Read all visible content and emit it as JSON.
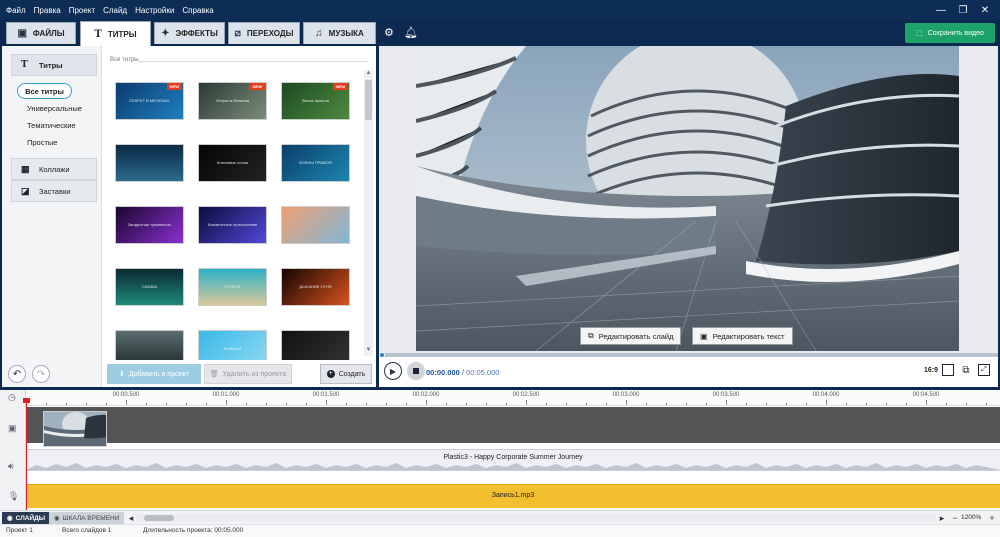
{
  "menu": [
    "Файл",
    "Правка",
    "Проект",
    "Слайд",
    "Настройки",
    "Справка"
  ],
  "tabs": [
    {
      "label": "ФАЙЛЫ",
      "icon": "folder-icon"
    },
    {
      "label": "ТИТРЫ",
      "icon": "text-t-icon"
    },
    {
      "label": "ЭФФЕКТЫ",
      "icon": "effects-star-icon"
    },
    {
      "label": "ПЕРЕХОДЫ",
      "icon": "transitions-icon"
    },
    {
      "label": "МУЗЫКА",
      "icon": "music-note-icon"
    }
  ],
  "save_button": "Сохранить видео",
  "categories": {
    "titles": "Титры",
    "sub": [
      "Все титры",
      "Универсальные",
      "Тематические",
      "Простые"
    ],
    "collages": "Коллажи",
    "intros": "Заставки"
  },
  "gallery": {
    "header": "Все титры",
    "badge": "NEW",
    "items": [
      {
        "caption": "СЕКРЕТ В МЕЛОЧАХ",
        "new": true
      },
      {
        "caption": "Отпуск в Испании",
        "new": true
      },
      {
        "caption": "Весна пришла",
        "new": true
      },
      {
        "caption": "",
        "new": false
      },
      {
        "caption": "Ключевые слова",
        "new": false
      },
      {
        "caption": "ВОЛНЫ ПРИБОЯ",
        "new": false
      },
      {
        "caption": "Загадочная туманность",
        "new": false
      },
      {
        "caption": "Космическое путешествие",
        "new": false
      },
      {
        "caption": "",
        "new": false
      },
      {
        "caption": "СКАЗКА",
        "new": false
      },
      {
        "caption": "ОТПУСК",
        "new": false
      },
      {
        "caption": "ДЫХАНИЕ ОГНЯ",
        "new": false
      },
      {
        "caption": "",
        "new": false
      },
      {
        "caption": "БОКАЛЫ",
        "new": false
      },
      {
        "caption": "",
        "new": false
      }
    ]
  },
  "buttons": {
    "add": "Добавить в проект",
    "remove": "Удалить из проекта",
    "create": "Создать"
  },
  "preview": {
    "edit_slide": "Редактировать слайд",
    "edit_text": "Редактировать текст",
    "current_time": "00:00.000",
    "separator": "/",
    "total_time": "00:05.000",
    "aspect": "16:9",
    "progress": 0
  },
  "timeline": {
    "ticks": [
      "00:00.500",
      "00:01.000",
      "00:01.500",
      "00:02.000",
      "00:02.500",
      "00:03.000",
      "00:03.500",
      "00:04.000",
      "00:04.500"
    ],
    "audio_track": "Plastic3 - Happy Corporate Summer Journey",
    "voice_track": "Запись1.mp3"
  },
  "modes": {
    "slides": "СЛАЙДЫ",
    "timeline": "ШКАЛА ВРЕМЕНИ"
  },
  "zoom": "1200%",
  "status": {
    "project": "Проект 1",
    "total_slides": "Всего слайдов 1",
    "duration": "Длительность проекта: 00:05.000"
  },
  "colors": {
    "accent": "#1da36a",
    "titlebar": "#0d2d56",
    "voice_track": "#f2bf2e",
    "playhead": "#e02020"
  }
}
